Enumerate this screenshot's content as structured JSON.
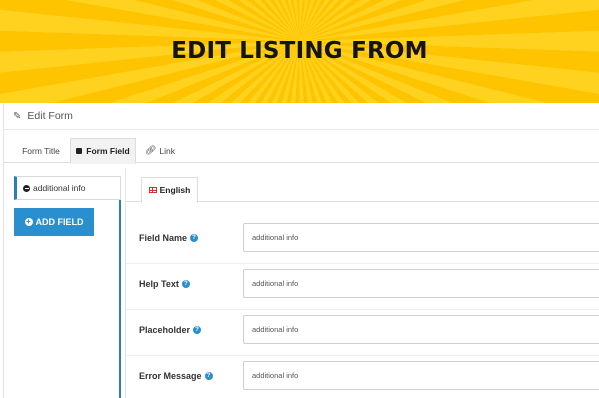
{
  "banner": {
    "title": "EDIT LISTING FROM"
  },
  "panel": {
    "title": "Edit Form",
    "tabs": [
      {
        "label": "Form Title"
      },
      {
        "label": "Form Field"
      },
      {
        "label": "Link"
      }
    ]
  },
  "sidebar": {
    "item_label": "additional info",
    "add_button": "ADD FIELD"
  },
  "content": {
    "language_tab": "English",
    "fields": [
      {
        "label": "Field Name",
        "value": "additional info"
      },
      {
        "label": "Help Text",
        "value": "additional info"
      },
      {
        "label": "Placeholder",
        "value": "additional info"
      },
      {
        "label": "Error Message",
        "value": "additional info"
      }
    ]
  },
  "colors": {
    "banner_yellow": "#ffc400",
    "accent_blue": "#2a8fce",
    "sidebar_border": "#2a7fb8"
  },
  "icons": {
    "panel_title": "pencil-icon",
    "tab_form_field": "square-icon",
    "tab_link": "link-icon",
    "sidebar_item": "minus-circle-icon",
    "add_button": "plus-circle-icon",
    "language": "uk-flag-icon",
    "help": "question-circle-icon"
  }
}
